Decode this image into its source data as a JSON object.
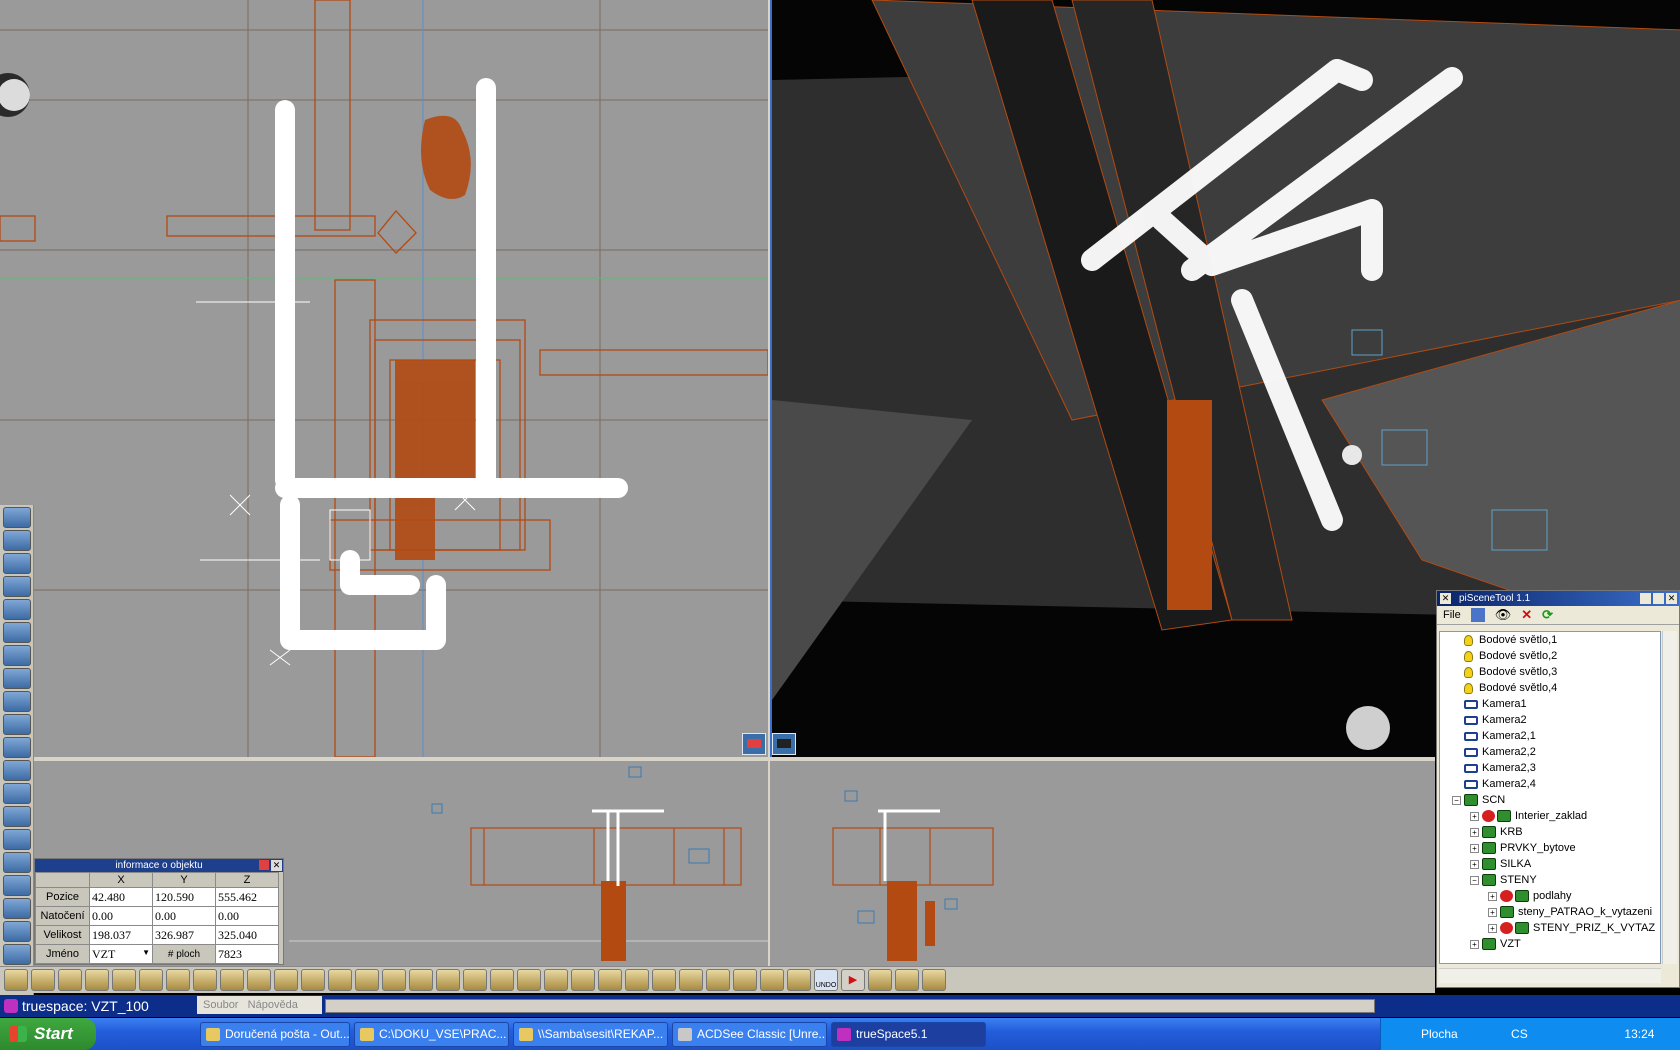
{
  "viewport_icons": [
    "camera-view-icon",
    "object-view-icon",
    "front-view-icon",
    "side-view-icon"
  ],
  "info_panel": {
    "title": "informace o objektu",
    "col_x": "X",
    "col_y": "Y",
    "col_z": "Z",
    "rows": [
      {
        "label": "Pozice",
        "x": "42.480",
        "y": "120.590",
        "z": "555.462"
      },
      {
        "label": "Natočení",
        "x": "0.00",
        "y": "0.00",
        "z": "0.00"
      },
      {
        "label": "Velikost",
        "x": "198.037",
        "y": "326.987",
        "z": "325.040"
      }
    ],
    "name_label": "Jméno",
    "name_value": "VZT",
    "faces_label": "# ploch",
    "faces_value": "7823"
  },
  "scene_tool": {
    "title": "piSceneTool 1.1",
    "menu_file": "File",
    "items": [
      {
        "label": "Bodové světlo,1",
        "type": "light",
        "depth": 0
      },
      {
        "label": "Bodové světlo,2",
        "type": "light",
        "depth": 0
      },
      {
        "label": "Bodové světlo,3",
        "type": "light",
        "depth": 0
      },
      {
        "label": "Bodové světlo,4",
        "type": "light",
        "depth": 0
      },
      {
        "label": "Kamera1",
        "type": "camera",
        "depth": 0
      },
      {
        "label": "Kamera2",
        "type": "camera",
        "depth": 0
      },
      {
        "label": "Kamera2,1",
        "type": "camera",
        "depth": 0
      },
      {
        "label": "Kamera2,2",
        "type": "camera",
        "depth": 0
      },
      {
        "label": "Kamera2,3",
        "type": "camera",
        "depth": 0
      },
      {
        "label": "Kamera2,4",
        "type": "camera",
        "depth": 0
      },
      {
        "label": "SCN",
        "type": "group",
        "depth": 0,
        "expand": "−"
      },
      {
        "label": "Interier_zaklad",
        "type": "group-eye",
        "depth": 1,
        "expand": "+"
      },
      {
        "label": "KRB",
        "type": "group",
        "depth": 1,
        "expand": "+"
      },
      {
        "label": "PRVKY_bytove",
        "type": "group",
        "depth": 1,
        "expand": "+"
      },
      {
        "label": "SILKA",
        "type": "group",
        "depth": 1,
        "expand": "+"
      },
      {
        "label": "STENY",
        "type": "group",
        "depth": 1,
        "expand": "−"
      },
      {
        "label": "podlahy",
        "type": "group-eye",
        "depth": 2,
        "expand": "+"
      },
      {
        "label": "steny_PATRAO_k_vytazeni",
        "type": "group",
        "depth": 2,
        "expand": "+"
      },
      {
        "label": "STENY_PRIZ_K_VYTAZ",
        "type": "group-eye",
        "depth": 2,
        "expand": "+"
      },
      {
        "label": "VZT",
        "type": "group",
        "depth": 1,
        "expand": "+"
      }
    ]
  },
  "status": {
    "title": "truespace: VZT_100",
    "menu_file": "Soubor",
    "menu_help": "Nápověda"
  },
  "bottom_toolbar": {
    "undo_label": "UNDO"
  },
  "taskbar": {
    "start": "Start",
    "tasks": [
      {
        "label": "Doručená pošta - Out..."
      },
      {
        "label": "C:\\DOKU_VSE\\PRAC..."
      },
      {
        "label": "\\\\Samba\\sesit\\REKAP..."
      },
      {
        "label": "ACDSee Classic [Unre..."
      },
      {
        "label": "trueSpace5.1",
        "active": true
      }
    ],
    "desktop_label": "Plocha",
    "lang": "CS",
    "clock": "13:24"
  },
  "colors": {
    "wire": "#b24a12",
    "selected": "#ffffff",
    "viewport_bg": "#9a9a9a",
    "persp_bg": "#050505"
  }
}
